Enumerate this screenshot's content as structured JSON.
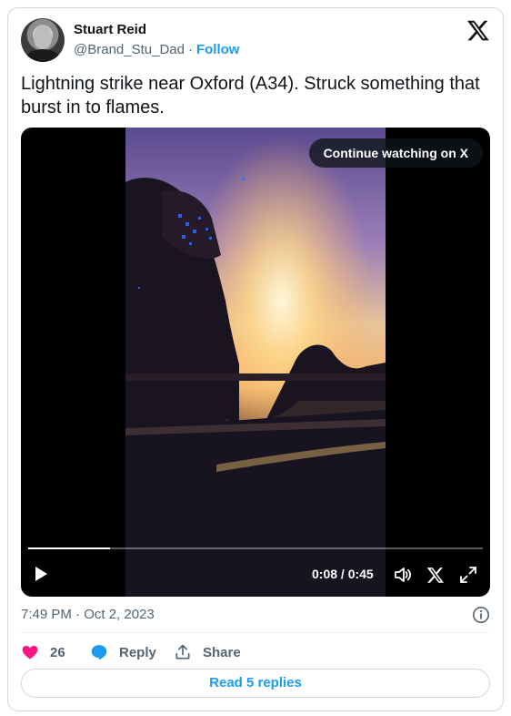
{
  "author": {
    "name": "Stuart Reid",
    "handle": "@Brand_Stu_Dad",
    "separator": "·",
    "follow_label": "Follow"
  },
  "tweet": {
    "text": "Lightning strike near Oxford (A34). Struck something that burst in to flames."
  },
  "video": {
    "continue_label": "Continue watching on X",
    "time": "0:08 / 0:45",
    "progress_fraction": 0.18
  },
  "meta": {
    "timestamp": "7:49 PM · Oct 2, 2023"
  },
  "actions": {
    "like_count": "26",
    "reply_label": "Reply",
    "share_label": "Share"
  },
  "replies_button_label": "Read 5 replies",
  "colors": {
    "accent": "#1d9bf0",
    "like": "#f91880",
    "secondary_text": "#536471",
    "border": "#cfd9de"
  },
  "icons": [
    "x-logo-icon",
    "play-icon",
    "volume-icon",
    "x-video-icon",
    "fullscreen-icon",
    "info-icon",
    "heart-icon",
    "reply-icon",
    "share-icon"
  ]
}
